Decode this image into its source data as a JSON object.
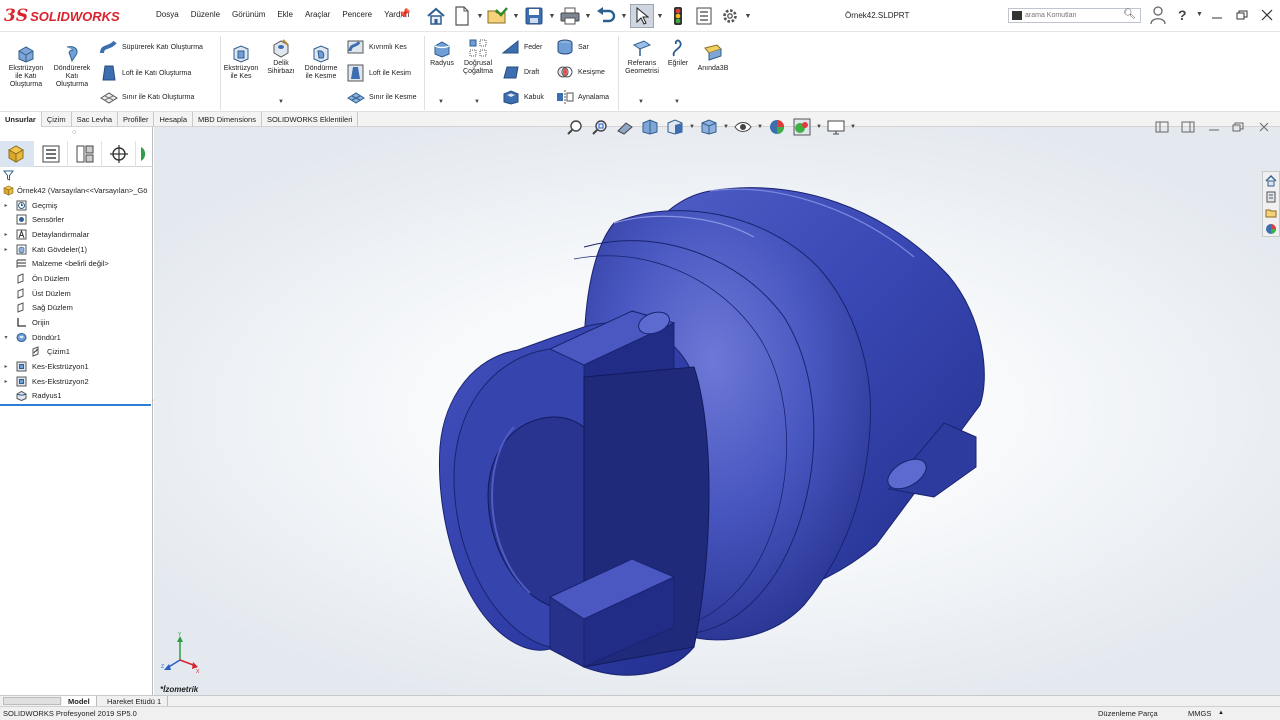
{
  "app": {
    "logo_mark": "3S",
    "logo_text": "SOLIDWORKS",
    "file_name": "Örnek42.SLDPRT"
  },
  "menu": [
    "Dosya",
    "Düzenle",
    "Görünüm",
    "Ekle",
    "Araçlar",
    "Pencere",
    "Yardım"
  ],
  "quick_access": [
    "home-icon",
    "new-document-icon",
    "open-icon",
    "save-icon",
    "print-icon",
    "undo-icon",
    "select-arrow-icon",
    "rebuild-traffic-light-icon",
    "file-properties-icon",
    "options-gear-icon"
  ],
  "search": {
    "placeholder": "arama Komutları"
  },
  "ribbon": {
    "extrude_boss": "Ekstrüzyon ile Katı Oluşturma",
    "revolve_boss": "Döndürerek Katı Oluşturma",
    "sweep_boss": "Süpürerek Katı Oluşturma",
    "loft_boss": "Loft ile Katı Oluşturma",
    "boundary_boss": "Sınır ile Katı Oluşturma",
    "extrude_cut": "Ekstrüzyon ile Kes",
    "hole_wizard": "Delik Sihirbazı",
    "revolve_cut": "Döndürme ile Kesme",
    "swept_cut": "Kıvrımlı Kes",
    "loft_cut": "Loft ile Kesim",
    "boundary_cut": "Sınır ile Kesme",
    "fillet": "Radyus",
    "linear_pattern": "Doğrusal Çoğaltma",
    "rib": "Feder",
    "draft": "Draft",
    "shell": "Kabuk",
    "wrap": "Sar",
    "intersect": "Kesişme",
    "mirror": "Aynalama",
    "ref_geometry": "Referans Geometrisi",
    "curves": "Eğriler",
    "instant3d": "Anında3B"
  },
  "command_tabs": [
    "Unsurlar",
    "Çizim",
    "Sac Levha",
    "Profiller",
    "Hesapla",
    "MBD Dimensions",
    "SOLIDWORKS Eklentileri"
  ],
  "tree": {
    "root": "Örnek42  (Varsayılan<<Varsayılan>_Gö",
    "items": [
      {
        "label": "Geçmiş",
        "icon": "history-folder-icon",
        "expandable": true
      },
      {
        "label": "Sensörler",
        "icon": "sensor-icon",
        "expandable": false
      },
      {
        "label": "Detaylandırmalar",
        "icon": "annotations-icon",
        "expandable": true
      },
      {
        "label": "Katı Gövdeler(1)",
        "icon": "solid-bodies-icon",
        "expandable": true
      },
      {
        "label": "Malzeme <belirli değil>",
        "icon": "material-icon",
        "expandable": false
      },
      {
        "label": "Ön Düzlem",
        "icon": "plane-icon",
        "expandable": false
      },
      {
        "label": "Üst Düzlem",
        "icon": "plane-icon",
        "expandable": false
      },
      {
        "label": "Sağ Düzlem",
        "icon": "plane-icon",
        "expandable": false
      },
      {
        "label": "Orijin",
        "icon": "origin-icon",
        "expandable": false
      },
      {
        "label": "Döndür1",
        "icon": "revolve-feature-icon",
        "expandable": true,
        "expanded": true
      },
      {
        "label": "Çizim1",
        "icon": "sketch-icon",
        "expandable": false,
        "child": true
      },
      {
        "label": "Kes-Ekstrüzyon1",
        "icon": "cut-extrude-icon",
        "expandable": true
      },
      {
        "label": "Kes-Ekstrüzyon2",
        "icon": "cut-extrude-icon",
        "expandable": true
      },
      {
        "label": "Radyus1",
        "icon": "fillet-feature-icon",
        "expandable": false
      }
    ]
  },
  "graphics": {
    "view_name": "*İzometrik",
    "part_color": "#2f3fa8"
  },
  "bottom_tabs": [
    "Model",
    "Hareket Etüdü 1"
  ],
  "status": {
    "product": "SOLIDWORKS Profesyonel 2019 SP5.0",
    "mode": "Düzenleme Parça",
    "units": "MMGS"
  }
}
